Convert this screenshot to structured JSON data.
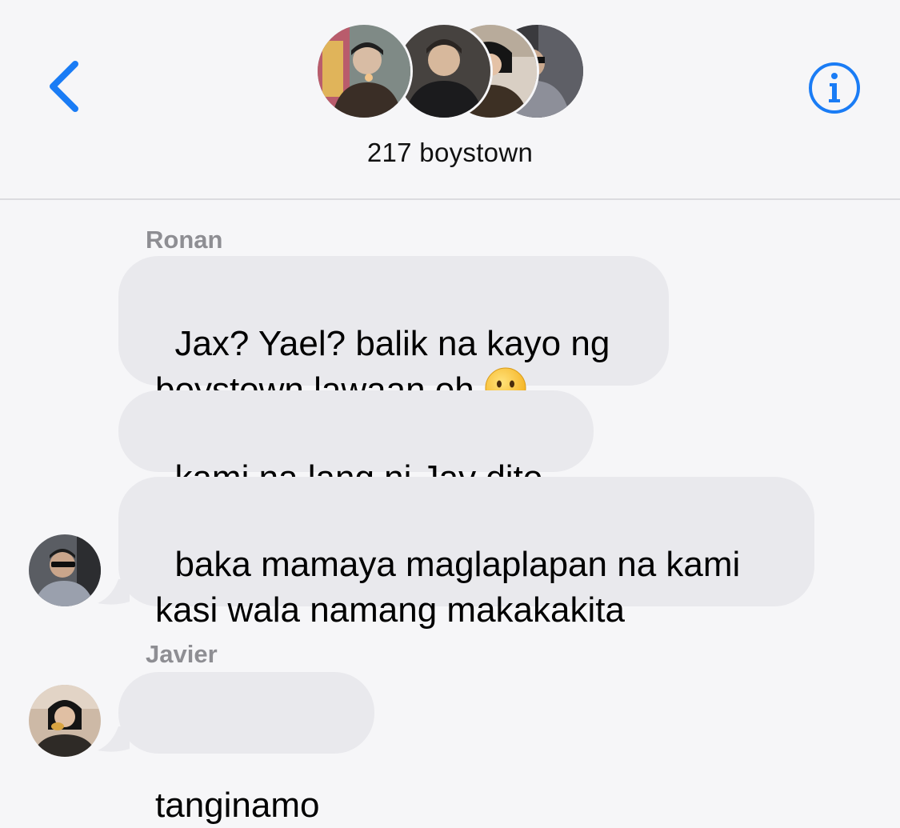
{
  "header": {
    "group_name": "217 boystown",
    "back_icon": "chevron-left-icon",
    "info_icon": "info-icon",
    "accent_color": "#1a7cf5"
  },
  "messages": [
    {
      "sender": "Ronan",
      "bubbles": [
        {
          "text": "Jax? Yael? balik na kayo ng\nboystown lawaan oh ",
          "emoji": "frowning-face-emoji"
        },
        {
          "text": "kami na lang ni Jav dito"
        },
        {
          "text": "baka mamaya maglaplapan na kami\nkasi wala namang makakakita"
        }
      ]
    },
    {
      "sender": "Javier",
      "bubbles": [
        {
          "text": "tanginamo"
        }
      ]
    }
  ],
  "colors": {
    "background": "#f6f6f8",
    "incoming_bubble": "#e9e9ed",
    "sender_label": "#8e8e93"
  }
}
